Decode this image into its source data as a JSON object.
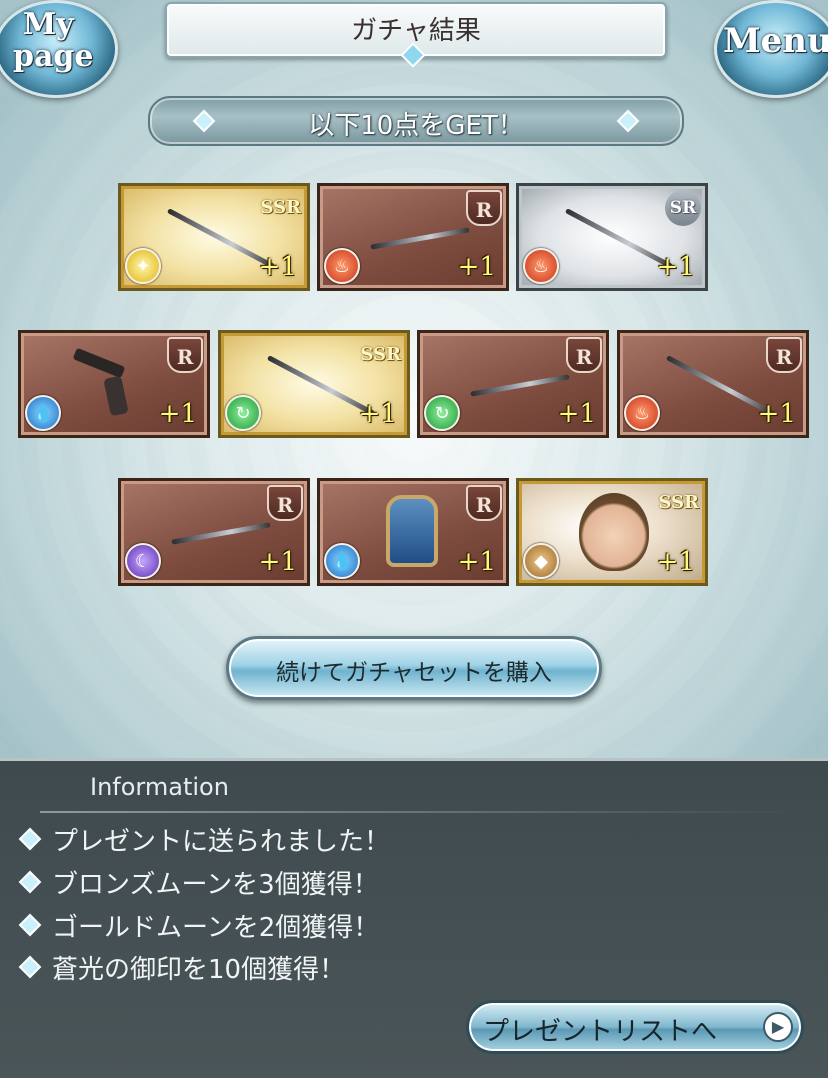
{
  "header": {
    "title": "ガチャ結果",
    "mypage_line1": "My",
    "mypage_line2": "page",
    "menu_label": "Menu"
  },
  "result_banner": "以下10点をGET！",
  "cards": [
    {
      "rarity": "SSR",
      "element": "light",
      "kind": "weapon",
      "count": "+1"
    },
    {
      "rarity": "R",
      "element": "fire",
      "kind": "weapon",
      "count": "+1"
    },
    {
      "rarity": "SR",
      "element": "fire",
      "kind": "weapon",
      "count": "+1"
    },
    {
      "rarity": "R",
      "element": "water",
      "kind": "gun",
      "count": "+1"
    },
    {
      "rarity": "SSR",
      "element": "wind",
      "kind": "weapon",
      "count": "+1"
    },
    {
      "rarity": "R",
      "element": "wind",
      "kind": "weapon",
      "count": "+1"
    },
    {
      "rarity": "R",
      "element": "fire",
      "kind": "weapon",
      "count": "+1"
    },
    {
      "rarity": "R",
      "element": "dark",
      "kind": "weapon",
      "count": "+1"
    },
    {
      "rarity": "R",
      "element": "water",
      "kind": "shield",
      "count": "+1"
    },
    {
      "rarity": "SSR",
      "element": "earth",
      "kind": "character",
      "count": "+1"
    }
  ],
  "continue_button": "続けてガチャセットを購入",
  "information": {
    "heading": "Information",
    "items": [
      "プレゼントに送られました！",
      "ブロンズムーンを3個獲得！",
      "ゴールドムーンを2個獲得！",
      "蒼光の御印を10個獲得！"
    ],
    "present_button": "プレゼントリストへ"
  }
}
